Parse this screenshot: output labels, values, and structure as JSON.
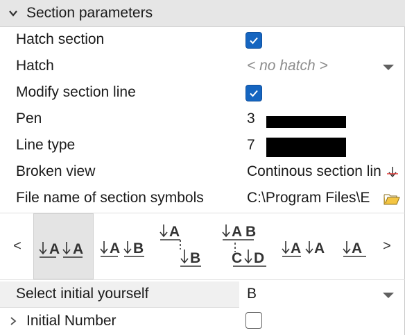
{
  "section": {
    "title": "Section parameters"
  },
  "rows": {
    "hatch_section": {
      "label": "Hatch section",
      "checked": true
    },
    "hatch": {
      "label": "Hatch",
      "placeholder": "< no hatch >"
    },
    "modify_section_line": {
      "label": "Modify section line",
      "checked": true
    },
    "pen": {
      "label": "Pen",
      "value": "3",
      "swatch_color": "#000000"
    },
    "line_type": {
      "label": "Line type",
      "value": "7",
      "swatch_color": "#000000"
    },
    "broken_view": {
      "label": "Broken view",
      "value": "Continous section lin"
    },
    "section_symbols": {
      "label": "File name of section symbols",
      "value": "C:\\Program Files\\E"
    }
  },
  "gallery": {
    "prev": "<",
    "next": ">",
    "tiles": [
      {
        "name": "symbol-style-1",
        "selected": true
      },
      {
        "name": "symbol-style-2",
        "selected": false
      },
      {
        "name": "symbol-style-3",
        "selected": false
      },
      {
        "name": "symbol-style-4",
        "selected": false
      },
      {
        "name": "symbol-style-5",
        "selected": false
      },
      {
        "name": "symbol-style-6",
        "selected": false
      }
    ],
    "glyphs": {
      "a": "A",
      "b": "B",
      "c": "C",
      "d": "D"
    }
  },
  "select_initial": {
    "label": "Select initial yourself",
    "value": "B"
  },
  "initial_number": {
    "label": "Initial Number",
    "checked": false
  },
  "colors": {
    "accent": "#1565c0",
    "header_bg": "#e6e6e6"
  }
}
